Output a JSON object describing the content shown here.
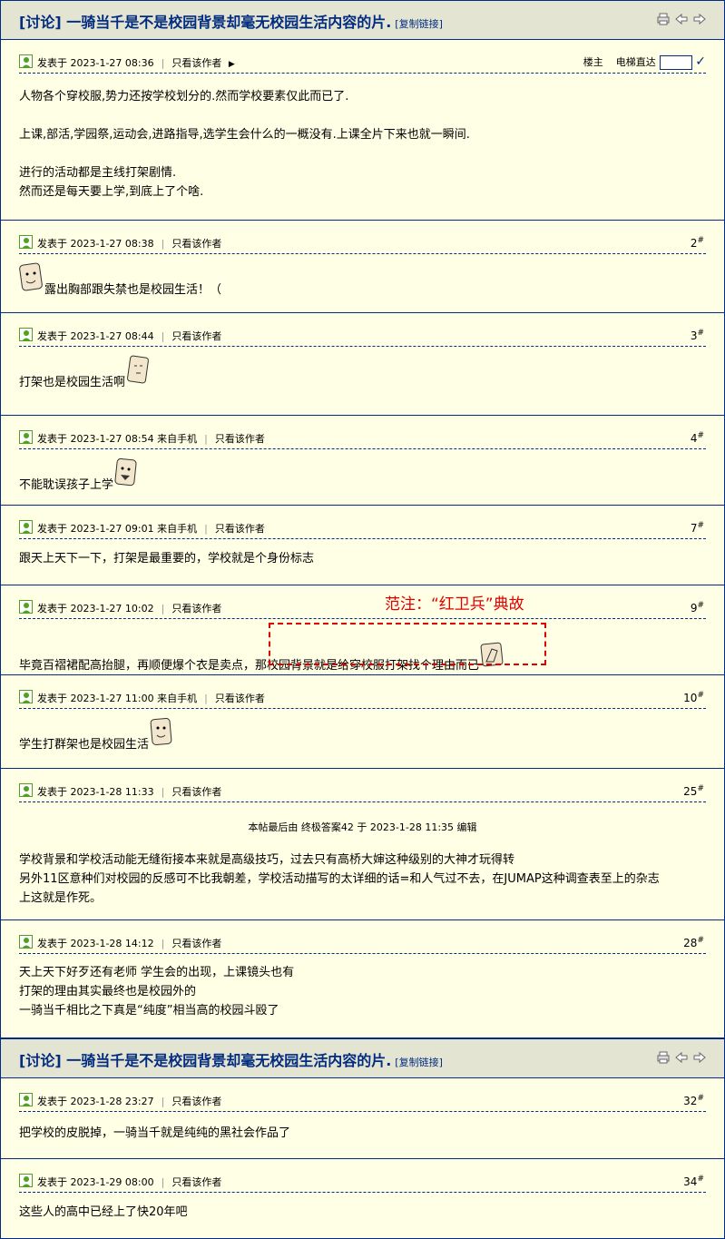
{
  "thread": {
    "title": "[讨论] 一骑当千是不是校园背景却毫无校园生活内容的片.",
    "copy_link": "[复制链接]"
  },
  "op": {
    "time": "发表于 2023-1-27 08:36",
    "only_author": "只看该作者",
    "louzhu": "楼主",
    "elevator": "电梯直达",
    "lines": [
      "人物各个穿校服,势力还按学校划分的.然而学校要素仅此而已了.",
      "上课,部活,学园祭,运动会,进路指导,选学生会什么的一概没有.上课全片下来也就一瞬间.",
      "进行的活动都是主线打架剧情.",
      "然而还是每天要上学,到底上了个啥."
    ]
  },
  "posts": [
    {
      "time": "发表于 2023-1-27 08:38",
      "only": "只看该作者",
      "floor": "2",
      "text": "露出胸部跟失禁也是校园生活！（"
    },
    {
      "time": "发表于 2023-1-27 08:44",
      "only": "只看该作者",
      "floor": "3",
      "text": "打架也是校园生活啊"
    },
    {
      "time": "发表于 2023-1-27 08:54 来自手机",
      "only": "只看该作者",
      "floor": "4",
      "text": "不能耽误孩子上学"
    },
    {
      "time": "发表于 2023-1-27 09:01 来自手机",
      "only": "只看该作者",
      "floor": "7",
      "text": "跟天上天下一下，打架是最重要的，学校就是个身份标志"
    },
    {
      "time": "发表于 2023-1-27 10:02",
      "only": "只看该作者",
      "floor": "9",
      "text": "毕竟百褶裙配高抬腿，再顺便爆个衣是卖点，那校园背景就是给穿校服打架找个理由而已"
    },
    {
      "time": "发表于 2023-1-27 11:00 来自手机",
      "only": "只看该作者",
      "floor": "10",
      "text": "学生打群架也是校园生活"
    },
    {
      "time": "发表于 2023-1-28 11:33",
      "only": "只看该作者",
      "floor": "25",
      "edit": "本帖最后由 终极答案42 于 2023-1-28 11:35 编辑",
      "lines": [
        "学校背景和学校活动能无缝衔接本来就是高级技巧，过去只有高桥大婶这种级别的大神才玩得转",
        "另外11区意种们对校园的反感可不比我朝差，学校活动描写的太详细的话=和人气过不去，在JUMAP这种调查表至上的杂志",
        "上这就是作死。"
      ]
    },
    {
      "time": "发表于 2023-1-28 14:12",
      "only": "只看该作者",
      "floor": "28",
      "lines": [
        "天上天下好歹还有老师 学生会的出现，上课镜头也有",
        "打架的理由其实最终也是校园外的",
        "一骑当千相比之下真是“纯度”相当高的校园斗殴了"
      ]
    },
    {
      "time": "发表于 2023-1-28 23:27",
      "only": "只看该作者",
      "floor": "32",
      "text": "把学校的皮脱掉，一骑当千就是纯纯的黑社会作品了"
    },
    {
      "time": "发表于 2023-1-29 08:00",
      "only": "只看该作者",
      "floor": "34",
      "text": "这些人的高中已经上了快20年吧"
    }
  ],
  "annotation": "范注：“红卫兵”典故",
  "colors": {
    "link": "#022C80",
    "bg": "#FFFFE5",
    "header": "#E4E4D3",
    "annotation": "#E00000"
  }
}
